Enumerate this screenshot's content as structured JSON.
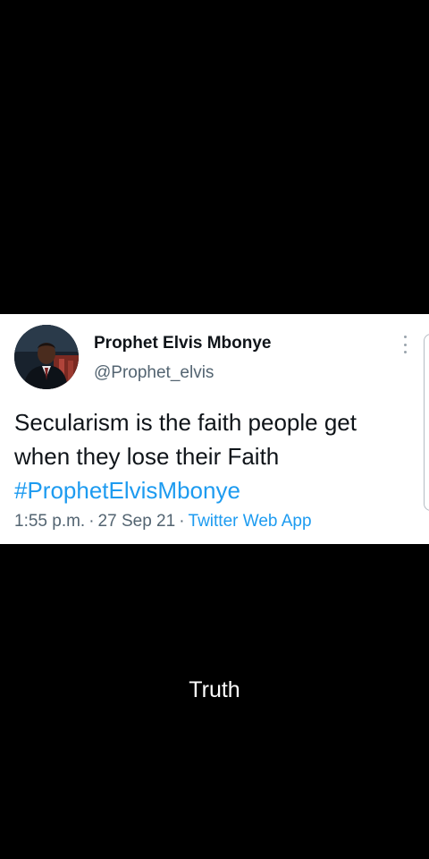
{
  "tweet": {
    "display_name": "Prophet Elvis Mbonye",
    "handle": "@Prophet_elvis",
    "text_line_1": "Secularism is the faith people get",
    "text_line_2": "when they lose their Faith",
    "hashtag": "#ProphetElvisMbonye",
    "time": "1:55 p.m.",
    "separator": "·",
    "date": "27 Sep 21",
    "source": "Twitter Web App",
    "more_icon": "more-vertical-icon"
  },
  "caption": "Truth",
  "colors": {
    "background": "#000000",
    "card": "#ffffff",
    "text": "#0f1419",
    "muted": "#536471",
    "link": "#1d9bf0"
  }
}
